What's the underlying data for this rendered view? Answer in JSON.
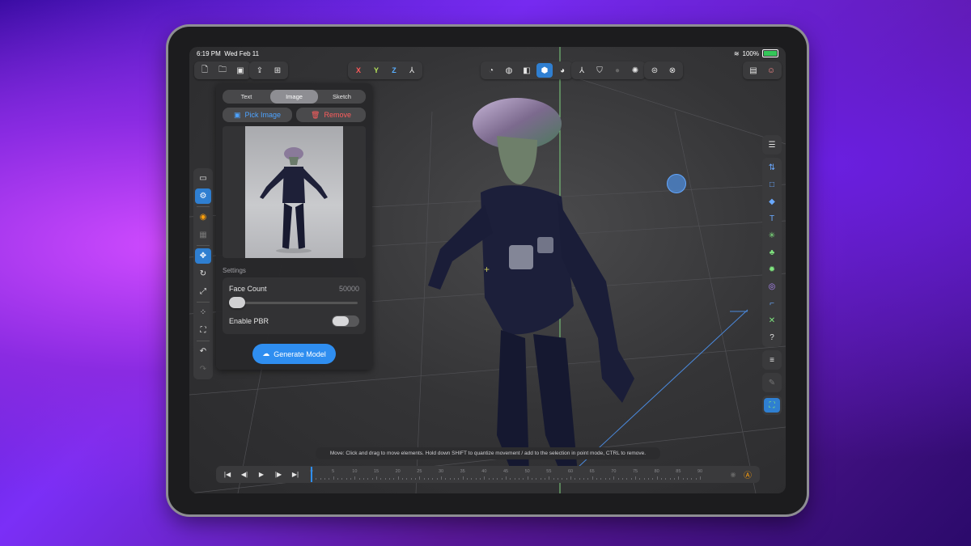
{
  "status_bar": {
    "time": "6:19 PM",
    "date": "Wed Feb 11",
    "battery": "100%"
  },
  "toolbar": {
    "file_group": [
      "new-file-icon",
      "open-folder-icon",
      "save-icon"
    ],
    "share_group": [
      "share-icon",
      "export-icon"
    ],
    "axes": {
      "x": "X",
      "y": "Y",
      "z": "Z"
    },
    "view_group": [
      "perspective-icon",
      "sphere-icon",
      "cube-icon",
      "ai-model-icon",
      "material-icon"
    ],
    "mesh_group": [
      "skeleton-icon",
      "bucket-icon",
      "dot-icon",
      "lasso-icon"
    ],
    "other_group": [
      "orbit-icon",
      "close-circle-icon"
    ],
    "right_group": [
      "clapper-icon",
      "avatar-icon"
    ]
  },
  "panel": {
    "tabs": [
      "Text",
      "Image",
      "Sketch"
    ],
    "selected_tab": "Image",
    "pick_image_label": "Pick Image",
    "remove_label": "Remove",
    "settings_label": "Settings",
    "face_count_label": "Face Count",
    "face_count_value": "50000",
    "face_count_slider_fraction": 0.02,
    "enable_pbr_label": "Enable PBR",
    "enable_pbr": false,
    "generate_label": "Generate Model"
  },
  "hint": "Move: Click and drag to move elements. Hold down SHIFT to quantize movement / add to the selection in point mode, CTRL to remove.",
  "timeline": {
    "ticks": [
      "0",
      "5",
      "10",
      "15",
      "20",
      "25",
      "30",
      "35",
      "40",
      "45",
      "50",
      "55",
      "60",
      "65",
      "70",
      "75",
      "80",
      "85",
      "90"
    ],
    "current_frame": 0
  },
  "colors": {
    "accent": "#2f8ef0",
    "axis_x": "#ff5a5a",
    "axis_y": "#b6e35a",
    "axis_z": "#5ab0ff"
  }
}
